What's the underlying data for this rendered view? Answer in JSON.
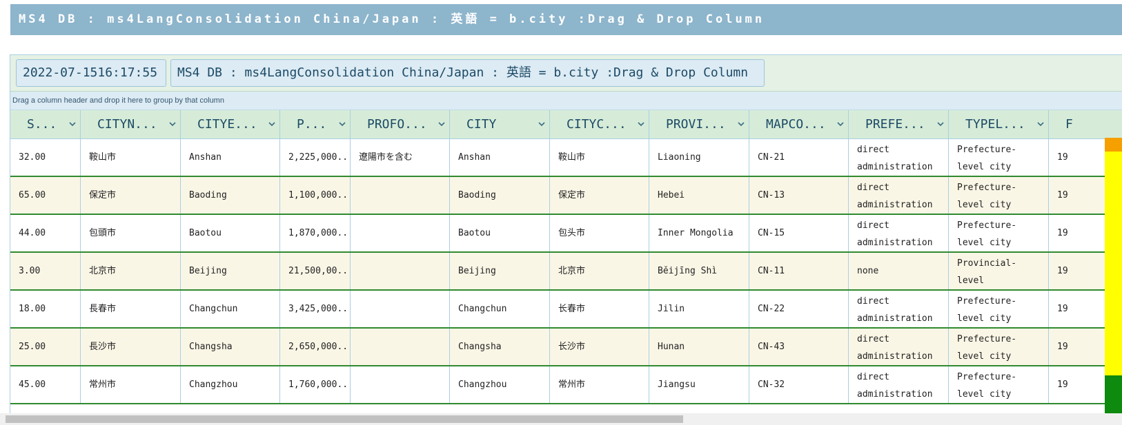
{
  "title_bar": "MS4 DB : ms4LangConsolidation China/Japan : 英語 = b.city :Drag & Drop Column",
  "toolbar": {
    "timestamp": "2022-07-1516:17:55",
    "title": "MS4 DB : ms4LangConsolidation China/Japan : 英語 = b.city :Drag & Drop Column"
  },
  "group_panel": "Drag a column header and drop it here to group by that column",
  "columns": [
    "S...",
    "CITYN...",
    "CITYE...",
    "P...",
    "PROFO...",
    "CITY",
    "CITYC...",
    "PROVI...",
    "MAPCO...",
    "PREFE...",
    "TYPEL...",
    "F"
  ],
  "rows": [
    [
      "32.00",
      "鞍山市",
      "Anshan",
      "2,225,000...",
      "遼陽市を含む",
      "Anshan",
      "鞍山市",
      "Liaoning",
      "CN-21",
      "direct administration",
      "Prefecture-level city",
      "19"
    ],
    [
      "65.00",
      "保定市",
      "Baoding",
      "1,100,000...",
      "",
      "Baoding",
      "保定市",
      "Hebei",
      "CN-13",
      "direct administration",
      "Prefecture-level city",
      "19"
    ],
    [
      "44.00",
      "包頭市",
      "Baotou",
      "1,870,000...",
      "",
      "Baotou",
      "包头市",
      "Inner Mongolia",
      "CN-15",
      "direct administration",
      "Prefecture-level city",
      "19"
    ],
    [
      "3.00",
      "北京市",
      "Beijing",
      "21,500,00...",
      "",
      "Beijing",
      "北京市",
      "Běijīng Shì",
      "CN-11",
      "none",
      "Provincial-level municipality",
      "19"
    ],
    [
      "18.00",
      "長春市",
      "Changchun",
      "3,425,000...",
      "",
      "Changchun",
      "长春市",
      "Jilin",
      "CN-22",
      "direct administration",
      "Prefecture-level city",
      "19"
    ],
    [
      "25.00",
      "長沙市",
      "Changsha",
      "2,650,000...",
      "",
      "Changsha",
      "长沙市",
      "Hunan",
      "CN-43",
      "direct administration",
      "Prefecture-level city",
      "19"
    ],
    [
      "45.00",
      "常州市",
      "Changzhou",
      "1,760,000...",
      "",
      "Changzhou",
      "常州市",
      "Jiangsu",
      "CN-32",
      "direct administration",
      "Prefecture-level city",
      "19"
    ]
  ],
  "colors": {
    "title_bar": "#8db5cc",
    "header": "#d6ecd8",
    "row_alt": "#faf6e6",
    "row_divider": "#2f8a2f",
    "strip_orange": "#f5a000",
    "strip_yellow": "#ffff00",
    "strip_green": "#0e8a0e"
  }
}
